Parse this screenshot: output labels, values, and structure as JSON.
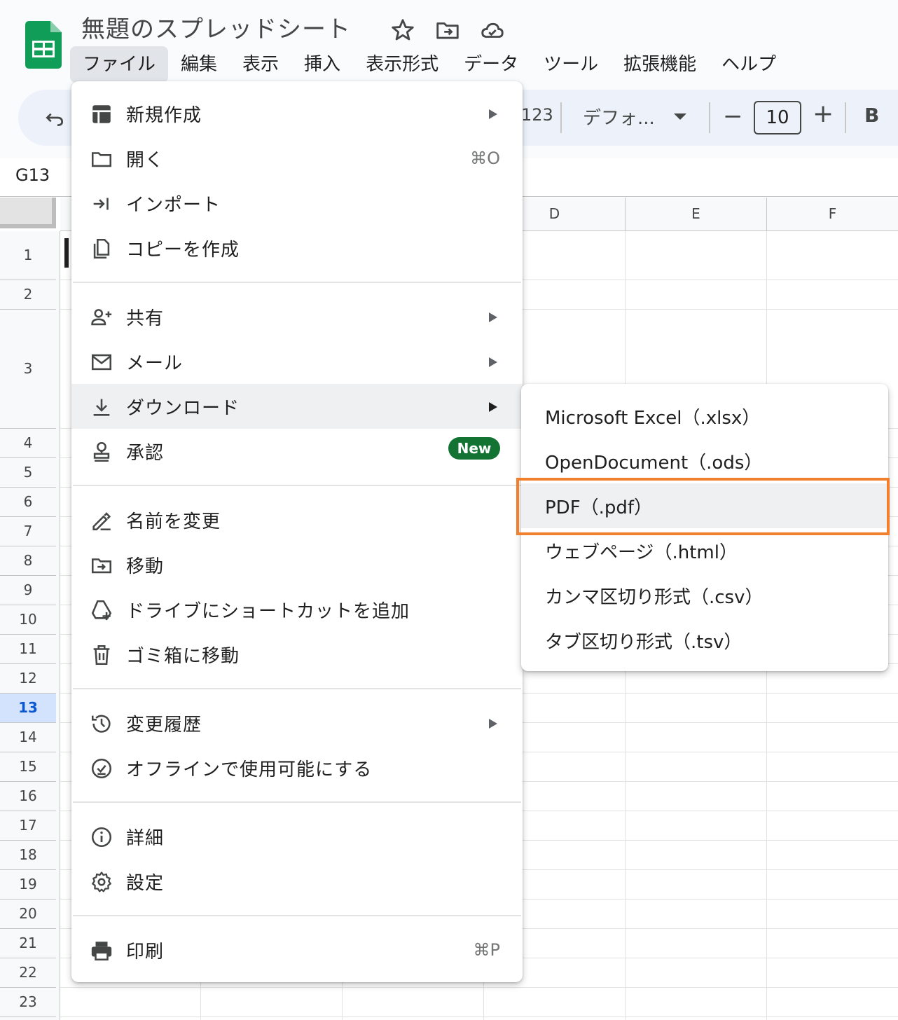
{
  "header": {
    "doc_title": "無題のスプレッドシート",
    "icons": [
      "star-icon",
      "move-to-folder-icon",
      "cloud-status-icon"
    ]
  },
  "menubar": [
    {
      "label": "ファイル",
      "active": true
    },
    {
      "label": "編集"
    },
    {
      "label": "表示"
    },
    {
      "label": "挿入"
    },
    {
      "label": "表示形式"
    },
    {
      "label": "データ"
    },
    {
      "label": "ツール"
    },
    {
      "label": "拡張機能"
    },
    {
      "label": "ヘルプ"
    }
  ],
  "toolbar": {
    "number_format": "123",
    "font_name": "デフォ...",
    "minus": "−",
    "font_size": "10",
    "plus": "+",
    "bold": "B"
  },
  "namebox": "G13",
  "grid": {
    "columns": [
      "D",
      "E",
      "F"
    ],
    "rows": [
      "1",
      "2",
      "3",
      "4",
      "5",
      "6",
      "7",
      "8",
      "9",
      "10",
      "11",
      "12",
      "13",
      "14",
      "15",
      "16",
      "17",
      "18",
      "19",
      "20",
      "21",
      "22",
      "23"
    ],
    "selected_row": "13"
  },
  "file_menu": {
    "items": [
      {
        "label": "新規作成",
        "icon": "new-sheet-icon",
        "submenu": true
      },
      {
        "label": "開く",
        "icon": "folder-open-icon",
        "shortcut": "⌘O"
      },
      {
        "label": "インポート",
        "icon": "import-icon"
      },
      {
        "label": "コピーを作成",
        "icon": "copy-icon"
      },
      {
        "label": "共有",
        "icon": "share-person-icon",
        "submenu": true
      },
      {
        "label": "メール",
        "icon": "mail-icon",
        "submenu": true
      },
      {
        "label": "ダウンロード",
        "icon": "download-icon",
        "submenu": true,
        "hover": true
      },
      {
        "label": "承認",
        "icon": "approval-icon",
        "badge": "New"
      },
      {
        "label": "名前を変更",
        "icon": "rename-icon"
      },
      {
        "label": "移動",
        "icon": "move-icon"
      },
      {
        "label": "ドライブにショートカットを追加",
        "icon": "drive-shortcut-icon"
      },
      {
        "label": "ゴミ箱に移動",
        "icon": "trash-icon"
      },
      {
        "label": "変更履歴",
        "icon": "history-icon",
        "submenu": true
      },
      {
        "label": "オフラインで使用可能にする",
        "icon": "offline-icon"
      },
      {
        "label": "詳細",
        "icon": "info-icon"
      },
      {
        "label": "設定",
        "icon": "settings-gear-icon"
      },
      {
        "label": "印刷",
        "icon": "print-icon",
        "shortcut": "⌘P"
      }
    ]
  },
  "download_submenu": {
    "items": [
      {
        "label": "Microsoft Excel（.xlsx）"
      },
      {
        "label": "OpenDocument（.ods）"
      },
      {
        "label": "PDF（.pdf）",
        "highlighted": true
      },
      {
        "label": "ウェブページ（.html）"
      },
      {
        "label": "カンマ区切り形式（.csv）"
      },
      {
        "label": "タブ区切り形式（.tsv）"
      }
    ]
  },
  "colors": {
    "sheets_green": "#0f9d58",
    "highlight_orange": "#f07f2e",
    "new_badge_green": "#137333",
    "selected_row_blue": "#d3e3fd"
  }
}
